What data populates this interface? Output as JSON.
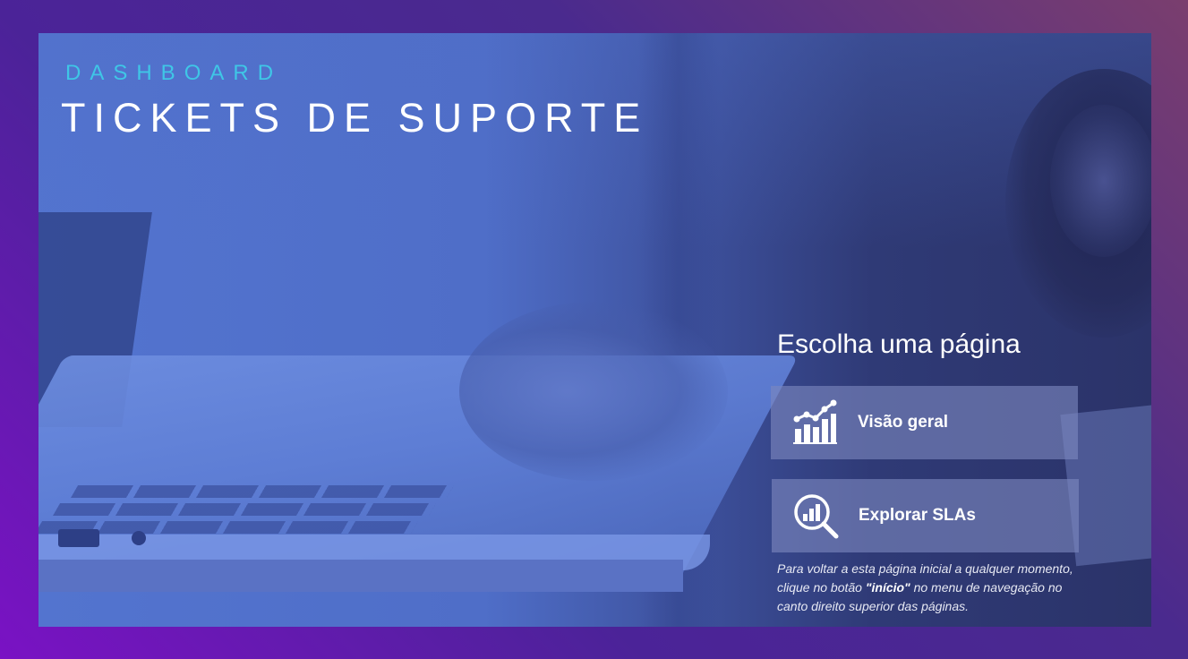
{
  "header": {
    "kicker": "DASHBOARD",
    "title": "TICKETS DE SUPORTE"
  },
  "menu": {
    "heading": "Escolha uma página",
    "buttons": [
      {
        "label": "Visão geral",
        "icon": "line-bar-chart-icon"
      },
      {
        "label": "Explorar SLAs",
        "icon": "magnifier-chart-icon"
      }
    ]
  },
  "hint": {
    "before": "Para voltar a esta página inicial a qualquer momento, clique no botão ",
    "button_name": "\"início\"",
    "after": " no menu de navegação no canto direito superior das páginas."
  },
  "colors": {
    "accent": "#3fc6e6",
    "text": "#ffffff",
    "button_bg": "#7d87be"
  }
}
